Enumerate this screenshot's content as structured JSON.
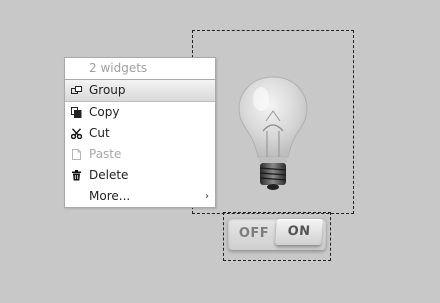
{
  "canvas": {
    "background": "#c8c8c8",
    "selection_border_color": "#222222"
  },
  "context_menu": {
    "header": "2 widgets",
    "items": [
      {
        "label": "Group",
        "icon": "group-icon",
        "highlighted": true,
        "disabled": false
      },
      {
        "label": "Copy",
        "icon": "copy-icon",
        "highlighted": false,
        "disabled": false
      },
      {
        "label": "Cut",
        "icon": "scissors-icon",
        "highlighted": false,
        "disabled": false
      },
      {
        "label": "Paste",
        "icon": "paste-icon",
        "highlighted": false,
        "disabled": true
      },
      {
        "label": "Delete",
        "icon": "trash-icon",
        "highlighted": false,
        "disabled": false
      },
      {
        "label": "More...",
        "icon": "",
        "highlighted": false,
        "disabled": false,
        "submenu": true
      }
    ],
    "submenu_arrow": "›"
  },
  "widgets": {
    "bulb": {
      "icon": "light-bulb-icon"
    },
    "toggle": {
      "off_label": "OFF",
      "on_label": "ON",
      "state": "on"
    }
  }
}
